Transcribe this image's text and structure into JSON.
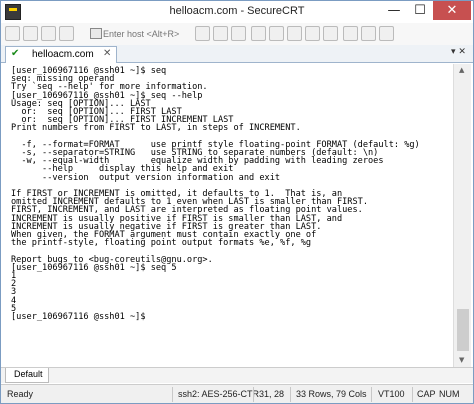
{
  "window": {
    "title": "helloacm.com - SecureCRT",
    "min": "—",
    "max": "☐",
    "close": "✕"
  },
  "toolbar": {
    "host_placeholder": "Enter host <Alt+R>"
  },
  "tab": {
    "label": "helloacm.com",
    "check": "✔",
    "close": "✕",
    "menu": "▾ ✕"
  },
  "terminal": {
    "lines": [
      "[user_106967116 @ssh01 ~]$ seq",
      "seq: missing operand",
      "Try `seq --help' for more information.",
      "[user_106967116 @ssh01 ~]$ seq --help",
      "Usage: seq [OPTION]... LAST",
      "  or:  seq [OPTION]... FIRST LAST",
      "  or:  seq [OPTION]... FIRST INCREMENT LAST",
      "Print numbers from FIRST to LAST, in steps of INCREMENT.",
      "",
      "  -f, --format=FORMAT      use printf style floating-point FORMAT (default: %g)",
      "  -s, --separator=STRING   use STRING to separate numbers (default: \\n)",
      "  -w, --equal-width        equalize width by padding with leading zeroes",
      "      --help     display this help and exit",
      "      --version  output version information and exit",
      "",
      "If FIRST or INCREMENT is omitted, it defaults to 1.  That is, an",
      "omitted INCREMENT defaults to 1 even when LAST is smaller than FIRST.",
      "FIRST, INCREMENT, and LAST are interpreted as floating point values.",
      "INCREMENT is usually positive if FIRST is smaller than LAST, and",
      "INCREMENT is usually negative if FIRST is greater than LAST.",
      "When given, the FORMAT argument must contain exactly one of",
      "the printf-style, floating point output formats %e, %f, %g",
      "",
      "Report bugs to <bug-coreutils@gnu.org>.",
      "[user_106967116 @ssh01 ~]$ seq 5",
      "1",
      "2",
      "3",
      "4",
      "5",
      "[user_106967116 @ssh01 ~]$ "
    ]
  },
  "session_tab": {
    "label": "Default"
  },
  "status": {
    "ready": "Ready",
    "cipher": "ssh2: AES-256-CTR",
    "cursor": "31, 28",
    "size": "33 Rows, 79 Cols",
    "term": "VT100",
    "cap": "CAP",
    "num": "NUM"
  }
}
